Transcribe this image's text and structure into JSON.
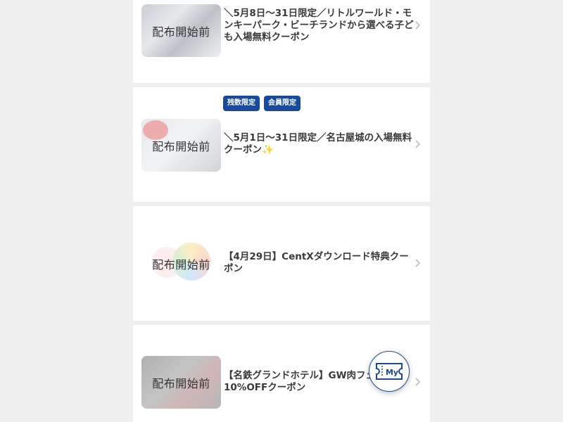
{
  "coupons": [
    {
      "status": "配布開始前",
      "title": "＼5月8日〜31日限定／リトルワールド・モンキーパーク・ビーチランドから選べる子ども入場無料クーポン",
      "badges": []
    },
    {
      "status": "配布開始前",
      "title": "＼5月1日〜31日限定／名古屋城の入場無料クーポン✨",
      "badges": [
        "残数限定",
        "会員限定"
      ]
    },
    {
      "status": "配布開始前",
      "title": "【4月29日】CentXダウンロード特典クーポン",
      "badges": []
    },
    {
      "status": "配布開始前",
      "title": "【名鉄グランドホテル】GW肉フェア 10%OFFクーポン",
      "badges": []
    }
  ],
  "floating_button": {
    "label": "My",
    "icon": "ticket-icon"
  },
  "colors": {
    "badge_bg": "#1a4a9c",
    "background": "#eeeeee",
    "card": "#ffffff"
  }
}
